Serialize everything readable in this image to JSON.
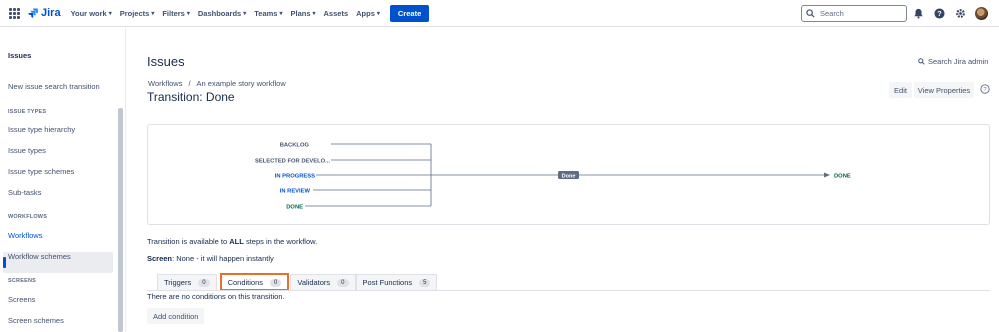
{
  "topnav": {
    "logo_text": "Jira",
    "menu": [
      {
        "label": "Your work"
      },
      {
        "label": "Projects"
      },
      {
        "label": "Filters"
      },
      {
        "label": "Dashboards"
      },
      {
        "label": "Teams"
      },
      {
        "label": "Plans"
      },
      {
        "label": "Assets"
      },
      {
        "label": "Apps"
      }
    ],
    "create_label": "Create",
    "search_placeholder": "Search",
    "brand_color": "#0052cc"
  },
  "sidebar": {
    "title": "Issues",
    "items": {
      "new_issue_search": "New issue search transition",
      "section_issue_types": "ISSUE TYPES",
      "type_hierarchy": "Issue type hierarchy",
      "issue_types": "Issue types",
      "type_schemes": "Issue type schemes",
      "subtasks": "Sub-tasks",
      "section_workflows": "WORKFLOWS",
      "workflows": "Workflows",
      "workflow_schemes": "Workflow schemes",
      "section_screens": "SCREENS",
      "screens": "Screens",
      "screen_schemes": "Screen schemes"
    }
  },
  "main": {
    "page_title": "Issues",
    "admin_search": "Search Jira admin",
    "breadcrumb": [
      "Workflows",
      "An example story workflow"
    ],
    "breadcrumb_sep": "/",
    "transition_title": "Transition: Done",
    "edit_label": "Edit",
    "view_properties_label": "View Properties",
    "diagram": {
      "statuses": [
        "BACKLOG",
        "SELECTED FOR DEVELO...",
        "IN PROGRESS",
        "IN REVIEW",
        "DONE"
      ],
      "transition_label": "Done",
      "target": "DONE"
    },
    "info_prefix": "Transition is available to ",
    "info_bold": "ALL",
    "info_suffix": " steps in the workflow.",
    "screen_label": "Screen",
    "screen_value": ": None - it will happen instantly",
    "tabs": [
      {
        "label": "Triggers",
        "count": "0"
      },
      {
        "label": "Conditions",
        "count": "0"
      },
      {
        "label": "Validators",
        "count": "0"
      },
      {
        "label": "Post Functions",
        "count": "5"
      }
    ],
    "no_conditions": "There are no conditions on this transition.",
    "add_condition": "Add condition",
    "highlight_color": "#e8702a"
  }
}
